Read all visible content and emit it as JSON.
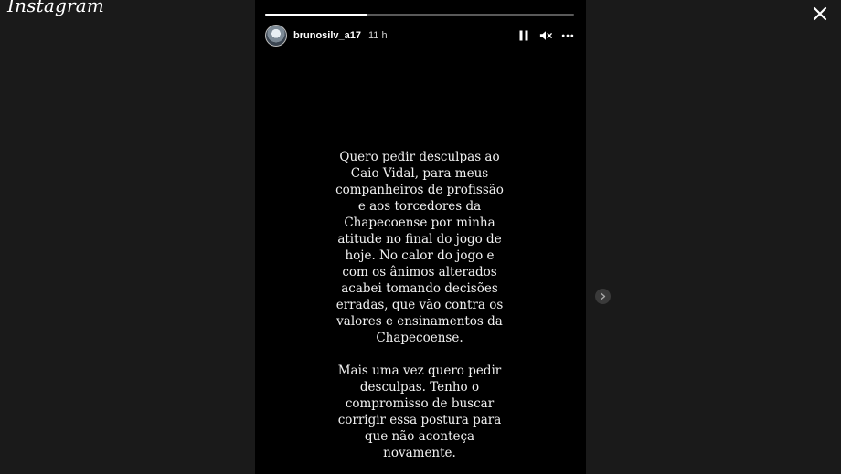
{
  "app": {
    "logo_text": "Instagram"
  },
  "story": {
    "username": "brunosilv_a17",
    "time": "11 h",
    "progress": 0.33,
    "paragraphs": [
      "Quero pedir desculpas ao\nCaio Vidal, para meus\ncompanheiros de profissão\ne aos torcedores da\nChapecoense por minha\natitude no final do jogo de\nhoje. No calor do jogo e\ncom os ânimos alterados\nacabei tomando decisões\nerradas, que vão contra os\nvalores e ensinamentos da\nChapecoense.",
      "Mais uma vez quero pedir\ndesculpas. Tenho o\ncompromisso de buscar\ncorrigir essa postura para\nque não aconteça\nnovamente."
    ]
  },
  "icons": {
    "close": "close-icon",
    "pause": "pause-icon",
    "mute": "muted-speaker-icon",
    "more": "more-options-icon",
    "next": "chevron-right-icon"
  }
}
